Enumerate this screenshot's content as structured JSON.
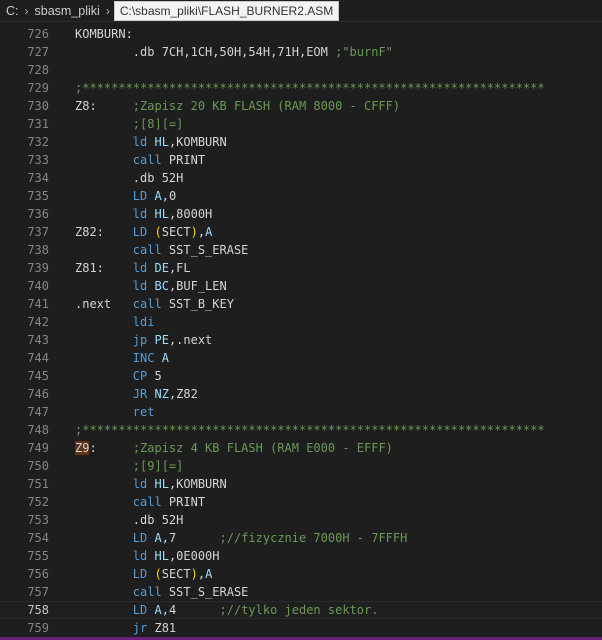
{
  "breadcrumb": {
    "drive": "C:",
    "folder": "sbasm_pliki",
    "file_path_tooltip": "C:\\sbasm_pliki\\FLASH_BURNER2.ASM"
  },
  "editor": {
    "current_line": 758,
    "lines": [
      {
        "n": "726",
        "segs": [
          {
            "t": "KOMBURN:",
            "c": "c-label"
          }
        ]
      },
      {
        "n": "727",
        "segs": [
          {
            "t": "        ",
            "c": "c-plain"
          },
          {
            "t": ".db 7CH,1CH,50H,54H,71H,EOM ",
            "c": "c-plain"
          },
          {
            "t": ";\"burnF\"",
            "c": "c-com"
          }
        ]
      },
      {
        "n": "728",
        "segs": []
      },
      {
        "n": "729",
        "segs": [
          {
            "t": ";****************************************************************",
            "c": "c-com"
          }
        ]
      },
      {
        "n": "730",
        "segs": [
          {
            "t": "Z8:     ",
            "c": "c-label"
          },
          {
            "t": ";Zapisz 20 KB FLASH (RAM 8000 - CFFF)",
            "c": "c-com"
          }
        ]
      },
      {
        "n": "731",
        "segs": [
          {
            "t": "        ",
            "c": "c-plain"
          },
          {
            "t": ";[8][=]",
            "c": "c-com"
          }
        ]
      },
      {
        "n": "732",
        "segs": [
          {
            "t": "        ",
            "c": "c-plain"
          },
          {
            "t": "ld ",
            "c": "c-kw"
          },
          {
            "t": "HL",
            "c": "c-reg"
          },
          {
            "t": ",KOMBURN",
            "c": "c-plain"
          }
        ]
      },
      {
        "n": "733",
        "segs": [
          {
            "t": "        ",
            "c": "c-plain"
          },
          {
            "t": "call ",
            "c": "c-kw"
          },
          {
            "t": "PRINT",
            "c": "c-plain"
          }
        ]
      },
      {
        "n": "734",
        "segs": [
          {
            "t": "        ",
            "c": "c-plain"
          },
          {
            "t": ".db 52H",
            "c": "c-plain"
          }
        ]
      },
      {
        "n": "735",
        "segs": [
          {
            "t": "        ",
            "c": "c-plain"
          },
          {
            "t": "LD ",
            "c": "c-kw"
          },
          {
            "t": "A",
            "c": "c-reg"
          },
          {
            "t": ",0",
            "c": "c-plain"
          }
        ]
      },
      {
        "n": "736",
        "segs": [
          {
            "t": "        ",
            "c": "c-plain"
          },
          {
            "t": "ld ",
            "c": "c-kw"
          },
          {
            "t": "HL",
            "c": "c-reg"
          },
          {
            "t": ",8000H",
            "c": "c-plain"
          }
        ]
      },
      {
        "n": "737",
        "segs": [
          {
            "t": "Z82:    ",
            "c": "c-label"
          },
          {
            "t": "LD ",
            "c": "c-kw"
          },
          {
            "t": "(",
            "c": "c-par"
          },
          {
            "t": "SECT",
            "c": "c-plain"
          },
          {
            "t": ")",
            "c": "c-par"
          },
          {
            "t": ",",
            "c": "c-plain"
          },
          {
            "t": "A",
            "c": "c-reg"
          }
        ]
      },
      {
        "n": "738",
        "segs": [
          {
            "t": "        ",
            "c": "c-plain"
          },
          {
            "t": "call ",
            "c": "c-kw"
          },
          {
            "t": "SST_S_ERASE",
            "c": "c-plain"
          }
        ]
      },
      {
        "n": "739",
        "segs": [
          {
            "t": "Z81:    ",
            "c": "c-label"
          },
          {
            "t": "ld ",
            "c": "c-kw"
          },
          {
            "t": "DE",
            "c": "c-reg"
          },
          {
            "t": ",FL",
            "c": "c-plain"
          }
        ]
      },
      {
        "n": "740",
        "segs": [
          {
            "t": "        ",
            "c": "c-plain"
          },
          {
            "t": "ld ",
            "c": "c-kw"
          },
          {
            "t": "BC",
            "c": "c-reg"
          },
          {
            "t": ",BUF_LEN",
            "c": "c-plain"
          }
        ]
      },
      {
        "n": "741",
        "segs": [
          {
            "t": ".next   ",
            "c": "c-label"
          },
          {
            "t": "call ",
            "c": "c-kw"
          },
          {
            "t": "SST_B_KEY",
            "c": "c-plain"
          }
        ]
      },
      {
        "n": "742",
        "segs": [
          {
            "t": "        ",
            "c": "c-plain"
          },
          {
            "t": "ldi",
            "c": "c-kw"
          }
        ]
      },
      {
        "n": "743",
        "segs": [
          {
            "t": "        ",
            "c": "c-plain"
          },
          {
            "t": "jp ",
            "c": "c-kw"
          },
          {
            "t": "PE",
            "c": "c-reg"
          },
          {
            "t": ",.next",
            "c": "c-plain"
          }
        ]
      },
      {
        "n": "744",
        "segs": [
          {
            "t": "        ",
            "c": "c-plain"
          },
          {
            "t": "INC ",
            "c": "c-kw"
          },
          {
            "t": "A",
            "c": "c-reg"
          }
        ]
      },
      {
        "n": "745",
        "segs": [
          {
            "t": "        ",
            "c": "c-plain"
          },
          {
            "t": "CP ",
            "c": "c-kw"
          },
          {
            "t": "5",
            "c": "c-plain"
          }
        ]
      },
      {
        "n": "746",
        "segs": [
          {
            "t": "        ",
            "c": "c-plain"
          },
          {
            "t": "JR ",
            "c": "c-kw"
          },
          {
            "t": "NZ",
            "c": "c-reg"
          },
          {
            "t": ",Z82",
            "c": "c-plain"
          }
        ]
      },
      {
        "n": "747",
        "segs": [
          {
            "t": "        ",
            "c": "c-plain"
          },
          {
            "t": "ret",
            "c": "c-kw"
          }
        ]
      },
      {
        "n": "748",
        "segs": [
          {
            "t": ";****************************************************************",
            "c": "c-com"
          }
        ]
      },
      {
        "n": "749",
        "segs": [
          {
            "t": "Z9",
            "c": "c-lbl-hi"
          },
          {
            "t": ":     ",
            "c": "c-label"
          },
          {
            "t": ";Zapisz 4 KB FLASH (RAM E000 - EFFF)",
            "c": "c-com"
          }
        ]
      },
      {
        "n": "750",
        "segs": [
          {
            "t": "        ",
            "c": "c-plain"
          },
          {
            "t": ";[9][=]",
            "c": "c-com"
          }
        ]
      },
      {
        "n": "751",
        "segs": [
          {
            "t": "        ",
            "c": "c-plain"
          },
          {
            "t": "ld ",
            "c": "c-kw"
          },
          {
            "t": "HL",
            "c": "c-reg"
          },
          {
            "t": ",KOMBURN",
            "c": "c-plain"
          }
        ]
      },
      {
        "n": "752",
        "segs": [
          {
            "t": "        ",
            "c": "c-plain"
          },
          {
            "t": "call ",
            "c": "c-kw"
          },
          {
            "t": "PRINT",
            "c": "c-plain"
          }
        ]
      },
      {
        "n": "753",
        "segs": [
          {
            "t": "        ",
            "c": "c-plain"
          },
          {
            "t": ".db 52H",
            "c": "c-plain"
          }
        ]
      },
      {
        "n": "754",
        "segs": [
          {
            "t": "        ",
            "c": "c-plain"
          },
          {
            "t": "LD ",
            "c": "c-kw"
          },
          {
            "t": "A",
            "c": "c-reg"
          },
          {
            "t": ",7      ",
            "c": "c-plain"
          },
          {
            "t": ";//fizycznie 7000H - 7FFFH",
            "c": "c-com"
          }
        ]
      },
      {
        "n": "755",
        "segs": [
          {
            "t": "        ",
            "c": "c-plain"
          },
          {
            "t": "ld ",
            "c": "c-kw"
          },
          {
            "t": "HL",
            "c": "c-reg"
          },
          {
            "t": ",0E000H",
            "c": "c-plain"
          }
        ]
      },
      {
        "n": "756",
        "segs": [
          {
            "t": "        ",
            "c": "c-plain"
          },
          {
            "t": "LD ",
            "c": "c-kw"
          },
          {
            "t": "(",
            "c": "c-par"
          },
          {
            "t": "SECT",
            "c": "c-plain"
          },
          {
            "t": ")",
            "c": "c-par"
          },
          {
            "t": ",",
            "c": "c-plain"
          },
          {
            "t": "A",
            "c": "c-reg"
          }
        ]
      },
      {
        "n": "757",
        "segs": [
          {
            "t": "        ",
            "c": "c-plain"
          },
          {
            "t": "call ",
            "c": "c-kw"
          },
          {
            "t": "SST_S_ERASE",
            "c": "c-plain"
          }
        ]
      },
      {
        "n": "758",
        "segs": [
          {
            "t": "        ",
            "c": "c-plain"
          },
          {
            "t": "LD ",
            "c": "c-kw"
          },
          {
            "t": "A",
            "c": "c-reg"
          },
          {
            "t": ",4      ",
            "c": "c-plain"
          },
          {
            "t": ";//tylko jeden sektor.",
            "c": "c-com"
          }
        ]
      },
      {
        "n": "759",
        "segs": [
          {
            "t": "        ",
            "c": "c-plain"
          },
          {
            "t": "jr ",
            "c": "c-kw"
          },
          {
            "t": "Z81",
            "c": "c-plain"
          }
        ]
      }
    ]
  }
}
